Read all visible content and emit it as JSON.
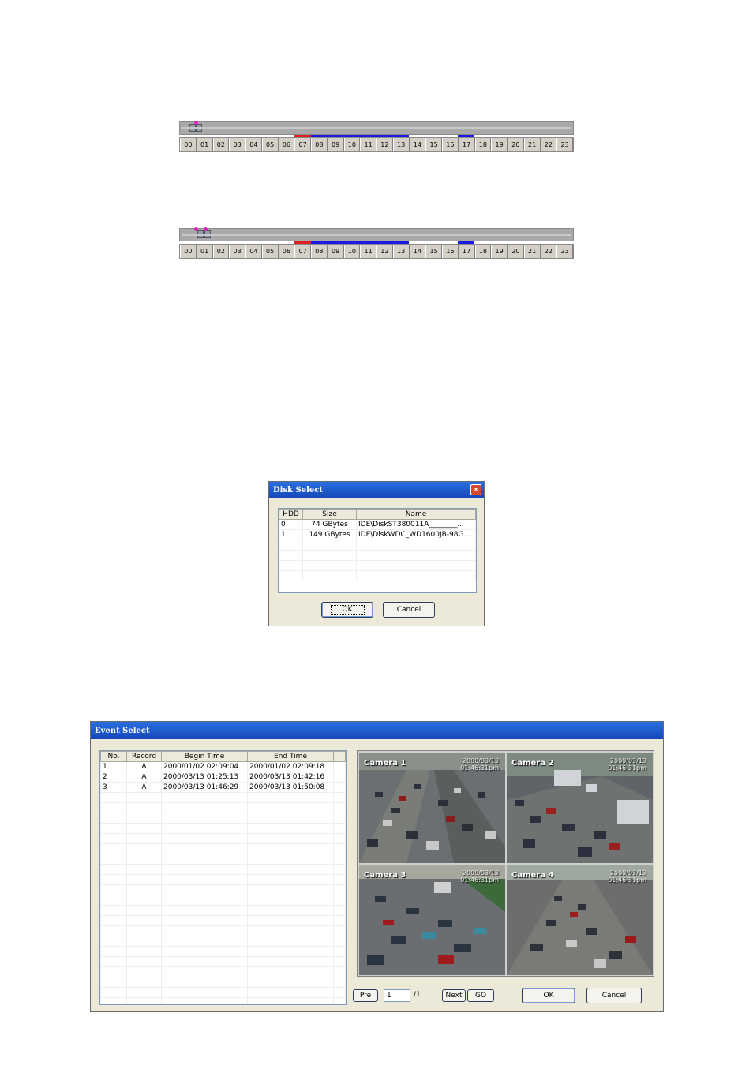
{
  "timeline1": {
    "hours": [
      "00",
      "01",
      "02",
      "03",
      "04",
      "05",
      "06",
      "07",
      "08",
      "09",
      "10",
      "11",
      "12",
      "13",
      "14",
      "15",
      "16",
      "17",
      "18",
      "19",
      "20",
      "21",
      "22",
      "23"
    ]
  },
  "timeline2": {
    "hours": [
      "00",
      "01",
      "02",
      "03",
      "04",
      "05",
      "06",
      "07",
      "08",
      "09",
      "10",
      "11",
      "12",
      "13",
      "14",
      "15",
      "16",
      "17",
      "18",
      "19",
      "20",
      "21",
      "22",
      "23"
    ]
  },
  "colors": {
    "band_red": "#e02020",
    "band_blue": "#1a1ae0",
    "marker_pin": "#e020c0"
  },
  "disk_select": {
    "title": "Disk Select",
    "columns": [
      "HDD",
      "Size",
      "Name"
    ],
    "rows": [
      [
        "0",
        "74 GBytes",
        "IDE\\DiskST380011A________..."
      ],
      [
        "1",
        "149 GBytes",
        "IDE\\DiskWDC_WD1600JB-98G..."
      ]
    ],
    "ok_label": "OK",
    "cancel_label": "Cancel",
    "close_icon": "close-icon"
  },
  "event_select": {
    "title": "Event Select",
    "columns": [
      "No.",
      "Record",
      "Begin Time",
      "End Time"
    ],
    "rows": [
      [
        "1",
        "A",
        "2000/01/02 02:09:04",
        "2000/01/02 02:09:18"
      ],
      [
        "2",
        "A",
        "2000/03/13 01:25:13",
        "2000/03/13 01:42:16"
      ],
      [
        "3",
        "A",
        "2000/03/13 01:46:29",
        "2000/03/13 01:50:08"
      ]
    ],
    "cameras": [
      {
        "label": "Camera 1",
        "date": "2000/03/13",
        "time": "01:46:31pm"
      },
      {
        "label": "Camera 2",
        "date": "2000/03/13",
        "time": "01:46:31pm"
      },
      {
        "label": "Camera 3",
        "date": "2000/03/13",
        "time": "01:46:31pm"
      },
      {
        "label": "Camera 4",
        "date": "2000/03/13",
        "time": "01:46:31pm"
      }
    ],
    "pre_label": "Pre",
    "page_value": "1",
    "page_total": "/1",
    "next_label": "Next",
    "go_label": "GO",
    "ok_label": "OK",
    "cancel_label": "Cancel"
  }
}
